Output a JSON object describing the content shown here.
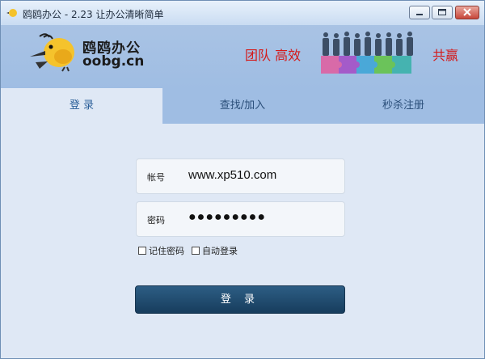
{
  "window": {
    "title": "鸥鸥办公 - 2.23 让办公清晰简单"
  },
  "header": {
    "logo_cn": "鸥鸥办公",
    "logo_en": "oobg.cn",
    "slogan_left": "团队 高效",
    "slogan_right": "共赢"
  },
  "tabs": [
    {
      "label": "登 录",
      "active": true
    },
    {
      "label": "查找/加入",
      "active": false
    },
    {
      "label": "秒杀注册",
      "active": false
    }
  ],
  "form": {
    "account_label": "帐号",
    "account_value": "www.xp510.com",
    "password_label": "密码",
    "password_value": "●●●●●●●●●",
    "remember_label": "记住密码",
    "autologin_label": "自动登录",
    "login_button": "登 录"
  },
  "colors": {
    "header_bg": "#a9c3e4",
    "body_bg": "#dfe8f5",
    "slogan_red": "#d41a1a",
    "button_dark_blue": "#1f4a6e"
  }
}
